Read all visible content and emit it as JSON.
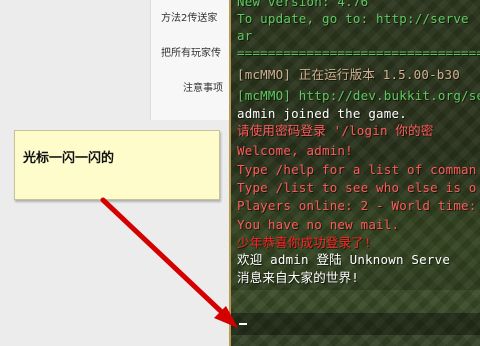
{
  "left_panel": {
    "items": [
      "方法2传送家",
      "把所有玩家传",
      "注意事项"
    ]
  },
  "console": {
    "lines": [
      {
        "text": "  New version: 4.76",
        "color": "#5ec95e"
      },
      {
        "text": "  To update, go to: http://serve",
        "color": "#5ec95e"
      },
      {
        "text": "ar",
        "color": "#5ec95e"
      },
      {
        "text": "====================================",
        "color": "#5ec95e"
      },
      {
        "text": "[mcMMO] 正在运行版本 1.5.00-b30",
        "color": "#d0b090"
      },
      {
        "text": "[mcMMO] http://dev.bukkit.org/ser",
        "color": "#5ec95e"
      },
      {
        "text": "admin joined the game.",
        "color": "#ffffff"
      },
      {
        "text": "请使用密码登录 '/login 你的密",
        "color": "#ff5a5a"
      },
      {
        "text": "Welcome, admin!",
        "color": "#ff5a5a"
      },
      {
        "text": "Type /help for a list of comman",
        "color": "#ff5a5a"
      },
      {
        "text": "Type /list to see who else is o",
        "color": "#ff5a5a"
      },
      {
        "text": "Players online: 2 - World time:",
        "color": "#ff5a5a"
      },
      {
        "text": "You have no new mail.",
        "color": "#ff5a5a"
      },
      {
        "text": "少年恭喜你成功登录了!",
        "color": "#ff2222"
      },
      {
        "text": "欢迎 admin 登陆 Unknown Serve",
        "color": "#ffffff"
      },
      {
        "text": "消息来自大家的世界!",
        "color": "#ffffff"
      }
    ],
    "input_text": ""
  },
  "annotation": {
    "text": "光标一闪一闪的",
    "arrow_color": "#d40000"
  }
}
